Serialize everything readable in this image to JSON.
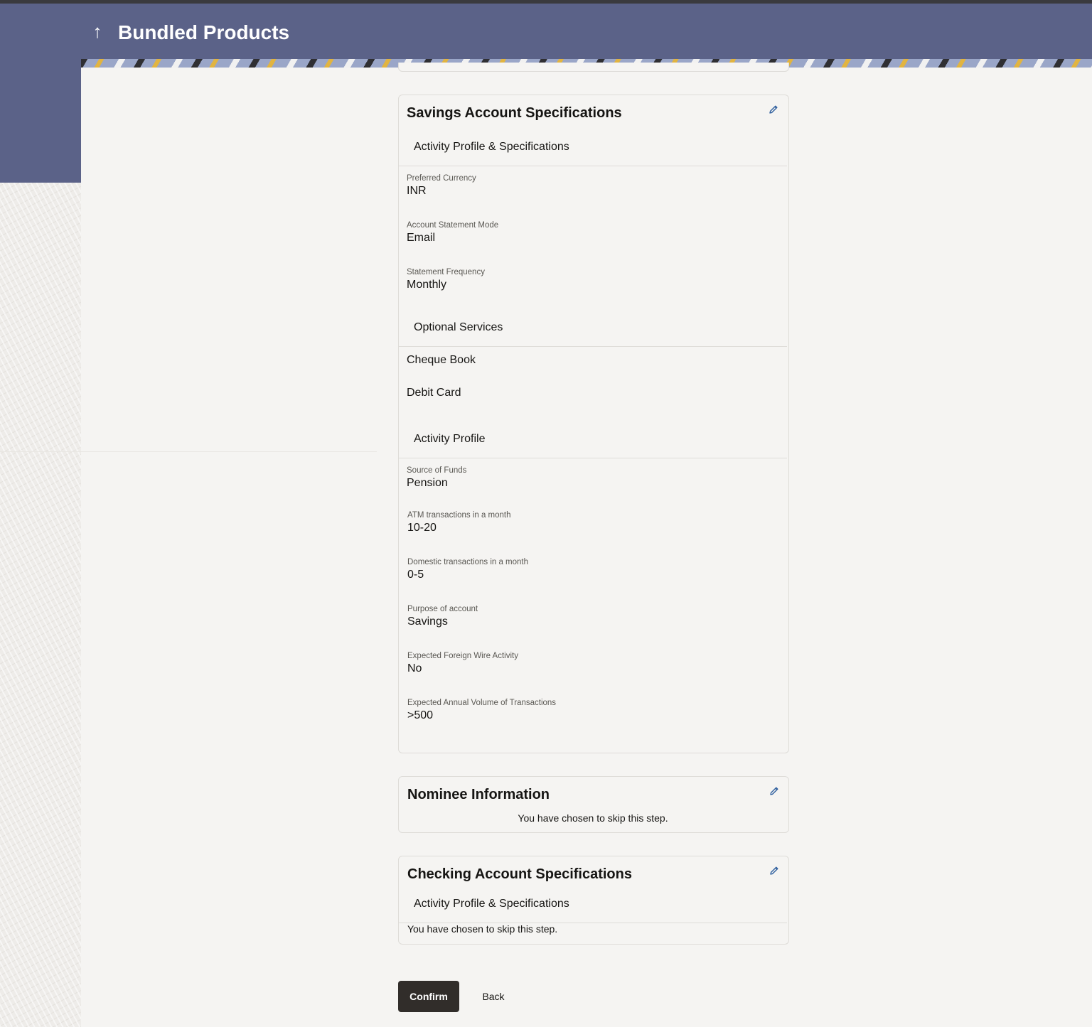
{
  "header": {
    "title": "Bundled Products",
    "back_icon": "arrow-up-icon"
  },
  "savings": {
    "title": "Savings Account Specifications",
    "edit_icon": "pencil-icon",
    "section_activity_specs": "Activity Profile & Specifications",
    "fields": [
      {
        "label": "Preferred Currency",
        "value": "INR"
      },
      {
        "label": "Account Statement Mode",
        "value": "Email"
      },
      {
        "label": "Statement Frequency",
        "value": "Monthly"
      }
    ],
    "section_optional": "Optional Services",
    "optional_services": [
      "Cheque Book",
      "Debit Card"
    ],
    "section_activity_profile": "Activity Profile",
    "activity_fields": [
      {
        "label": "Source of Funds",
        "value": "Pension"
      },
      {
        "label": "ATM transactions in a month",
        "value": "10-20"
      },
      {
        "label": "Domestic transactions in a month",
        "value": "0-5"
      },
      {
        "label": "Purpose of account",
        "value": "Savings"
      },
      {
        "label": "Expected Foreign Wire Activity",
        "value": "No"
      },
      {
        "label": "Expected Annual Volume of Transactions",
        "value": ">500"
      }
    ]
  },
  "nominee": {
    "title": "Nominee Information",
    "note": "You have chosen to skip this step."
  },
  "checking": {
    "title": "Checking Account Specifications",
    "section_activity_specs": "Activity Profile & Specifications",
    "note": "You have chosen to skip this step."
  },
  "actions": {
    "confirm_label": "Confirm",
    "back_label": "Back"
  },
  "colors": {
    "header_band": "#5b6288",
    "primary_button": "#312d2a",
    "edit_icon": "#2f5f9e"
  }
}
